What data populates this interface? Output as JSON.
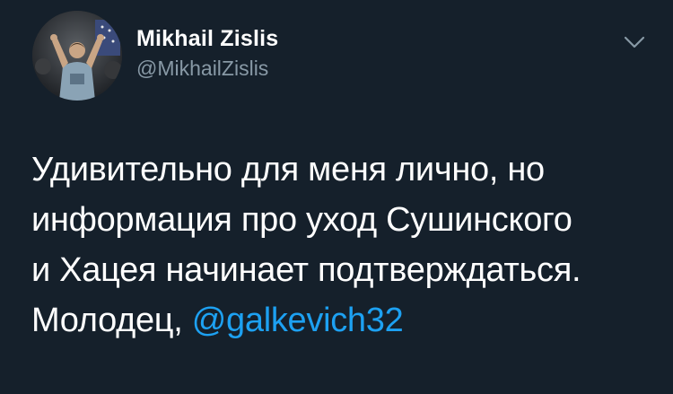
{
  "author": {
    "display_name": "Mikhail Zislis",
    "handle": "@MikhailZislis",
    "avatar_icon": "user-photo-avatar"
  },
  "menu": {
    "icon": "chevron-down-icon"
  },
  "tweet": {
    "line1": "Удивительно для меня лично, но",
    "line2": "информация про уход Сушинского",
    "line3": "и Хацея начинает подтверждаться.",
    "line4_prefix": "Молодец, ",
    "mention": "@galkevich32"
  },
  "colors": {
    "background": "#15202b",
    "text": "#ffffff",
    "secondary_text": "#8899a6",
    "link": "#1da1f2"
  }
}
